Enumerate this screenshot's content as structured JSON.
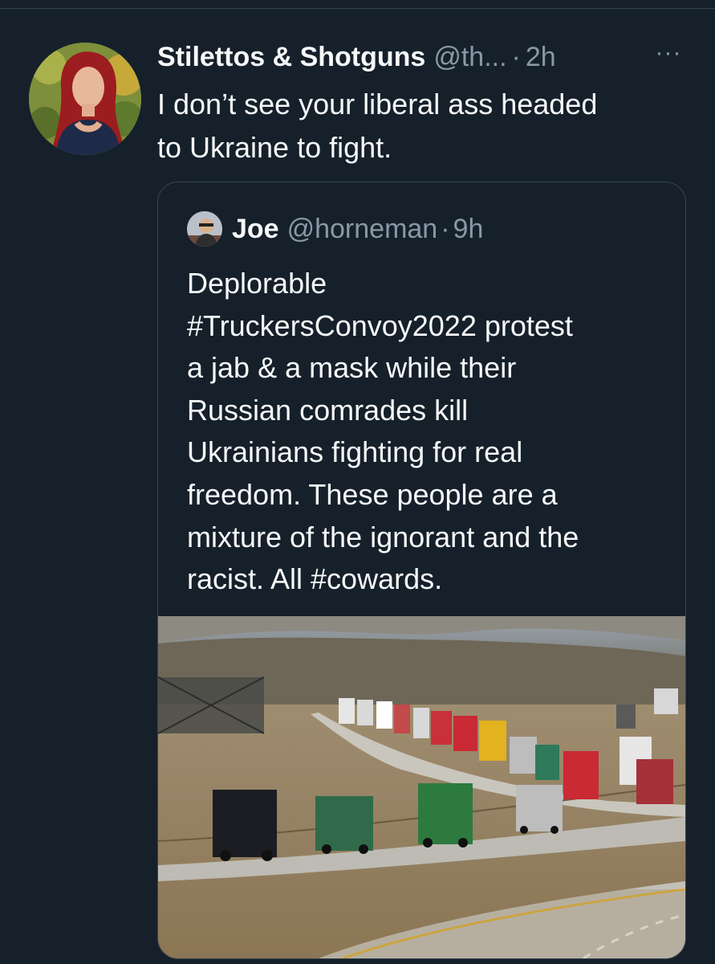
{
  "tweet": {
    "display_name": "Stilettos & Shotguns",
    "handle": "@th...",
    "dot": "·",
    "time": "2h",
    "more_label": "···",
    "text_lines": [
      "I don’t see your liberal ass headed",
      "to Ukraine to fight."
    ]
  },
  "quoted_tweet": {
    "display_name": "Joe",
    "handle": "@horneman",
    "dot": "·",
    "time": "9h",
    "text_lines": [
      "Deplorable",
      "#TruckersConvoy2022 protest",
      "a jab & a mask while their",
      "Russian comrades kill",
      "Ukrainians fighting for real",
      "freedom. These people are a",
      "mixture of the ignorant and the",
      "racist. All #cowards."
    ],
    "media_description_icon": "truck-convoy-photo"
  },
  "colors": {
    "background": "#15202b",
    "border": "#38444d",
    "primary_text": "#f7f9f9",
    "secondary_text": "#8b98a5"
  }
}
